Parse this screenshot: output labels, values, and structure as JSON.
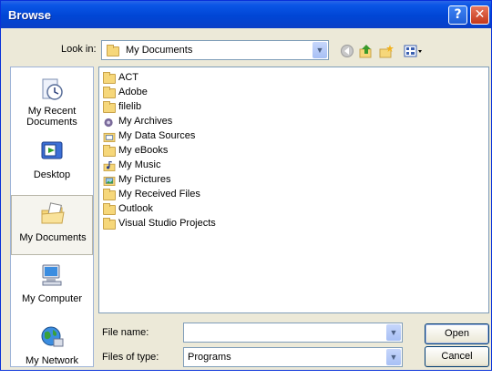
{
  "window": {
    "title": "Browse"
  },
  "title_buttons": {
    "help": "?",
    "close": "✕"
  },
  "look_in": {
    "label": "Look in:",
    "value": "My Documents"
  },
  "toolbar": {
    "icons": [
      "back-icon",
      "up-folder-icon",
      "new-folder-icon",
      "views-menu-icon"
    ]
  },
  "places": [
    {
      "label": "My Recent Documents",
      "icon": "recent-documents-icon",
      "selected": false
    },
    {
      "label": "Desktop",
      "icon": "desktop-icon",
      "selected": false
    },
    {
      "label": "My Documents",
      "icon": "my-documents-icon",
      "selected": true
    },
    {
      "label": "My Computer",
      "icon": "my-computer-icon",
      "selected": false
    },
    {
      "label": "My Network",
      "icon": "my-network-icon",
      "selected": false
    }
  ],
  "files": [
    {
      "name": "ACT",
      "icon": "folder"
    },
    {
      "name": "Adobe",
      "icon": "folder"
    },
    {
      "name": "filelib",
      "icon": "folder"
    },
    {
      "name": "My Archives",
      "icon": "special-folder"
    },
    {
      "name": "My Data Sources",
      "icon": "special-folder"
    },
    {
      "name": "My eBooks",
      "icon": "folder"
    },
    {
      "name": "My Music",
      "icon": "special-folder"
    },
    {
      "name": "My Pictures",
      "icon": "special-folder"
    },
    {
      "name": "My Received Files",
      "icon": "folder"
    },
    {
      "name": "Outlook",
      "icon": "folder"
    },
    {
      "name": "Visual Studio Projects",
      "icon": "folder"
    }
  ],
  "file_name": {
    "label": "File name:",
    "value": ""
  },
  "file_type": {
    "label": "Files of type:",
    "value": "Programs"
  },
  "buttons": {
    "open": "Open",
    "cancel": "Cancel"
  }
}
